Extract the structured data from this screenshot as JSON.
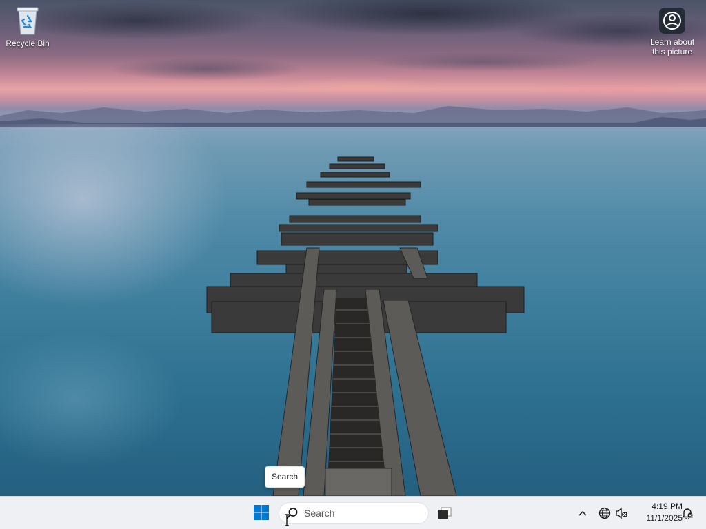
{
  "desktop": {
    "icons": [
      {
        "label": "Recycle Bin",
        "icon": "recycle-bin-icon"
      },
      {
        "label": "Learn about this picture",
        "icon": "camera-circle-icon"
      }
    ]
  },
  "tooltip": {
    "text": "Search"
  },
  "taskbar": {
    "start_icon": "windows-logo-icon",
    "search_placeholder": "Search",
    "taskview_icon": "task-view-icon",
    "tray": {
      "chevron_icon": "chevron-up-icon",
      "network_icon": "globe-network-icon",
      "volume_icon": "speaker-muted-icon",
      "time": "4:19 PM",
      "date": "11/1/2025",
      "notification_icon": "bell-icon"
    },
    "colors": {
      "background": "#eef0f3",
      "windows_blue": "#0078d4"
    }
  }
}
